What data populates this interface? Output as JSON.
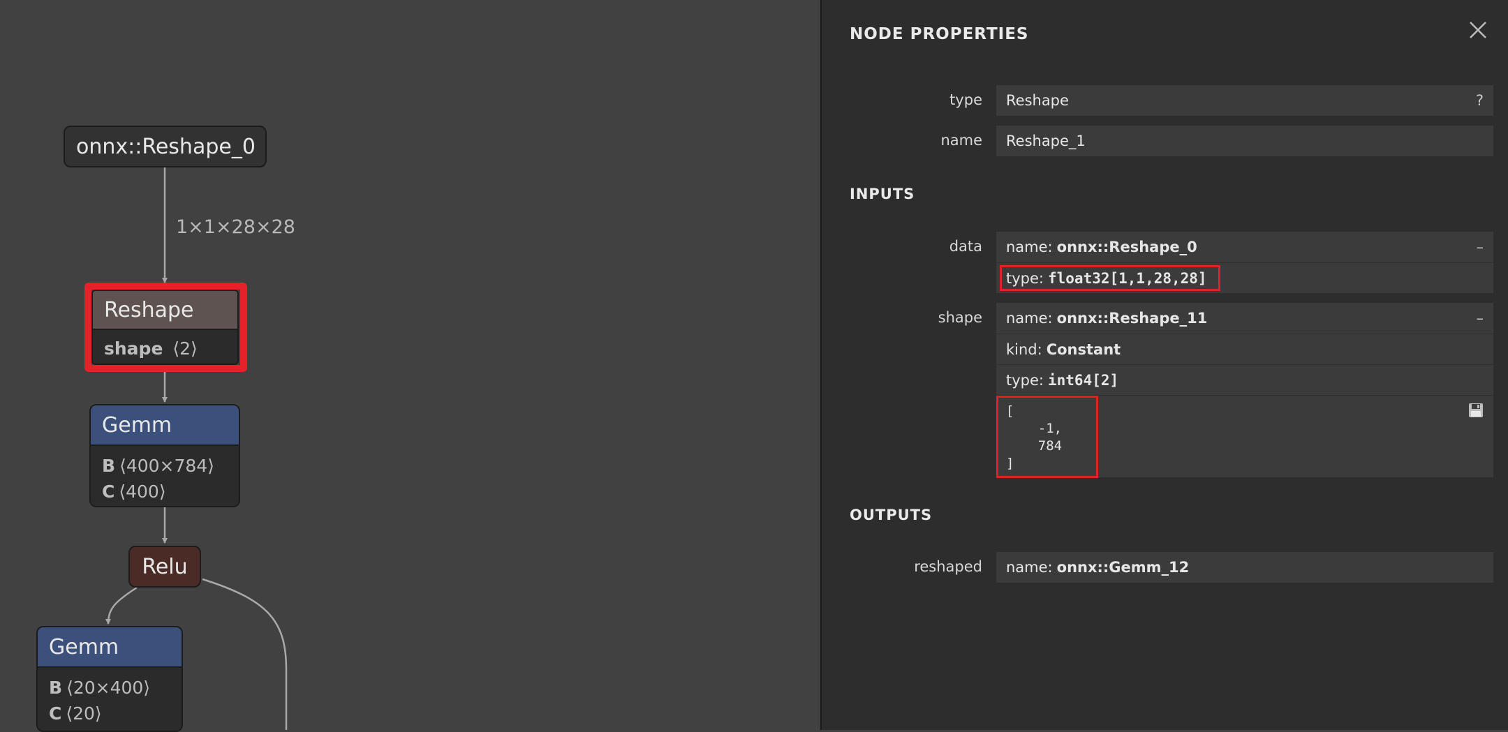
{
  "graph": {
    "input_node": {
      "label": "onnx::Reshape_0"
    },
    "edge_label": "1×1×28×28",
    "reshape_node": {
      "title": "Reshape",
      "attr_name": "shape",
      "attr_value": "⟨2⟩"
    },
    "gemm1_node": {
      "title": "Gemm",
      "rows": [
        {
          "name": "B",
          "value": "⟨400×784⟩"
        },
        {
          "name": "C",
          "value": "⟨400⟩"
        }
      ]
    },
    "relu_node": {
      "title": "Relu"
    },
    "gemm2_node": {
      "title": "Gemm",
      "rows": [
        {
          "name": "B",
          "value": "⟨20×400⟩"
        },
        {
          "name": "C",
          "value": "⟨20⟩"
        }
      ]
    }
  },
  "panel": {
    "title": "NODE PROPERTIES",
    "close_icon": "close-icon",
    "type_label": "type",
    "type_value": "Reshape",
    "help_button": "?",
    "name_label": "name",
    "name_value": "Reshape_1",
    "inputs_title": "INPUTS",
    "inputs": {
      "data": {
        "label": "data",
        "name_key": "name:",
        "name_value": "onnx::Reshape_0",
        "type_key": "type:",
        "type_value": "float32[1,1,28,28]",
        "collapse": "–"
      },
      "shape": {
        "label": "shape",
        "name_key": "name:",
        "name_value": "onnx::Reshape_11",
        "kind_key": "kind:",
        "kind_value": "Constant",
        "type_key": "type:",
        "type_value": "int64[2]",
        "collapse": "–",
        "value_lines": [
          "[",
          "    -1,",
          "    784",
          "]"
        ],
        "save_icon": "save-icon"
      }
    },
    "outputs_title": "OUTPUTS",
    "outputs": {
      "reshaped": {
        "label": "reshaped",
        "name_key": "name:",
        "name_value": "onnx::Gemm_12"
      }
    }
  },
  "colors": {
    "graph_bg": "#414141",
    "panel_bg": "#2d2d2d",
    "reshape_header": "#5e5350",
    "gemm_header": "#3b507b",
    "relu_bg": "#4a2b26",
    "highlight_red": "#e5222a"
  }
}
